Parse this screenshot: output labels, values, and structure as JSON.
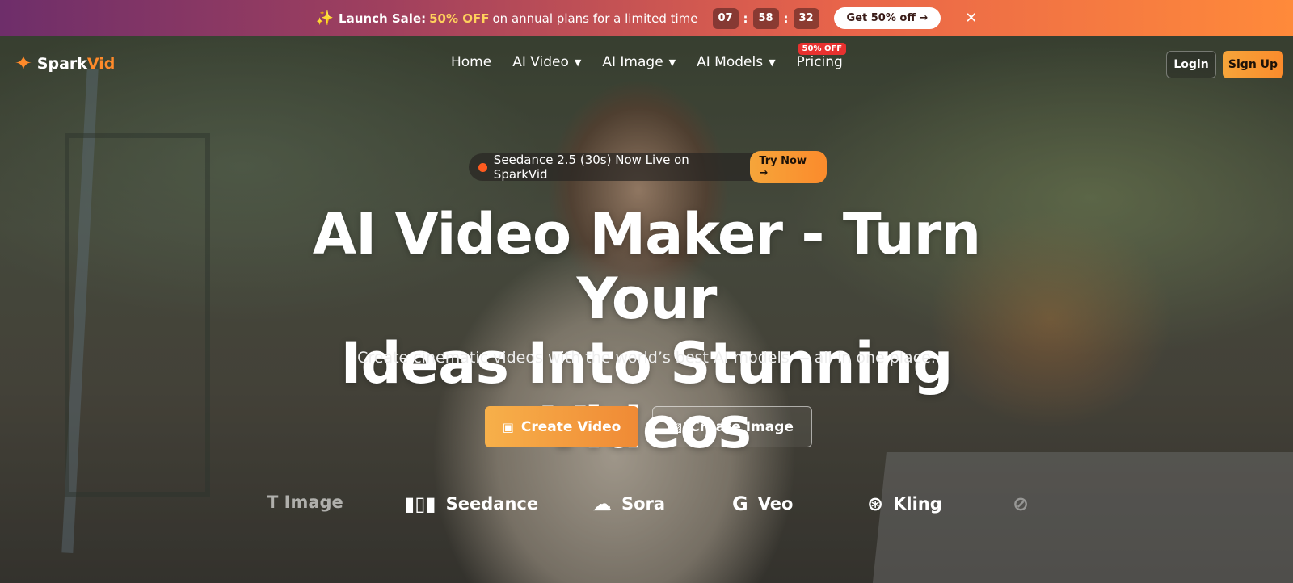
{
  "promo": {
    "spark_icon": "sparkle-icon",
    "label": "Launch Sale:",
    "highlight": "50% OFF",
    "text": "on annual plans for a limited time",
    "timer": {
      "hours": "07",
      "minutes": "58",
      "seconds": "32",
      "sep": ":"
    },
    "button": "Get 50% off →",
    "close": "✕"
  },
  "nav": {
    "logo_spark": "Spark",
    "logo_vid": "Vid",
    "items": [
      {
        "label": "Home"
      },
      {
        "label": "AI Video",
        "chevron": "⌄"
      },
      {
        "label": "AI Image",
        "chevron": "⌄"
      },
      {
        "label": "AI Models",
        "chevron": "⌄"
      },
      {
        "label": "Pricing",
        "badge": "50% OFF"
      }
    ],
    "login": "Login",
    "signup": "Sign Up"
  },
  "hero": {
    "announcement": "Seedance 2.5 (30s) Now Live on SparkVid",
    "try_now": "Try Now →",
    "headline_line1": "AI Video Maker - Turn Your",
    "headline_line2": "Ideas Into Stunning Videos",
    "subtitle": "Create cinematic videos with the world’s best AI models — all in one place.",
    "cta_video": "Create Video",
    "cta_image": "Create Image"
  },
  "models": [
    {
      "name": "T Image",
      "icon": ""
    },
    {
      "name": "Seedance",
      "icon": "bars-icon"
    },
    {
      "name": "Sora",
      "icon": "cloud-icon"
    },
    {
      "name": "Veo",
      "icon": "g-icon"
    },
    {
      "name": "Kling",
      "icon": "swirl-icon"
    }
  ],
  "colors": {
    "accent": "#fb8b2c",
    "badge": "#e8312f",
    "highlight": "#ffd15c"
  }
}
